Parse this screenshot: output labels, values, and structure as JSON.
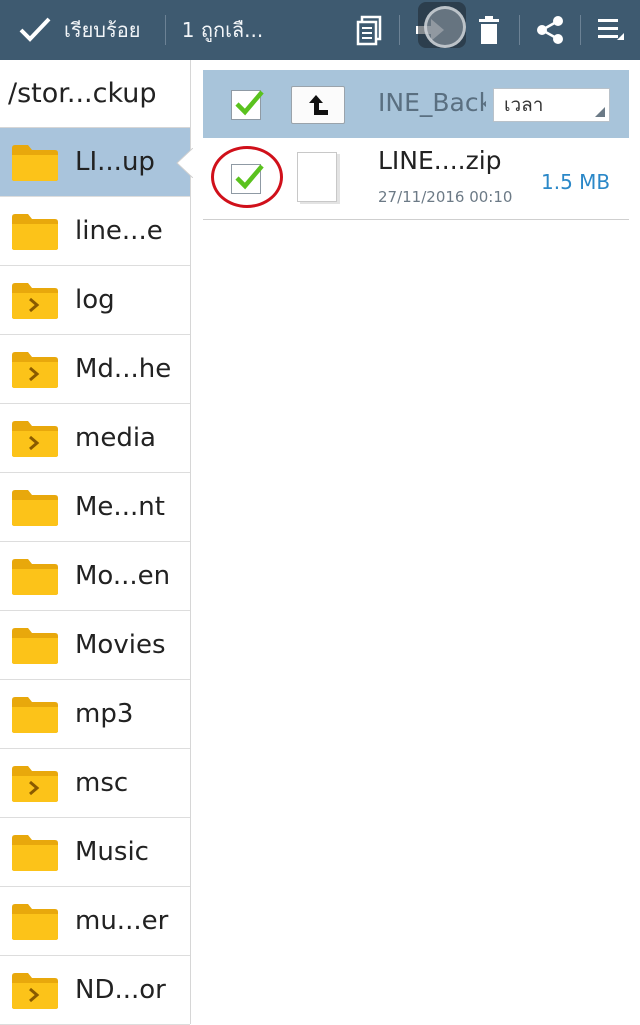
{
  "actionbar": {
    "done_label": "เรียบร้อย",
    "selected_label": "1 ถูกเลื...",
    "background": "#3e5a70"
  },
  "left_pane": {
    "path": "/stor...ckup",
    "folders": [
      {
        "name": "LI...up",
        "active": true,
        "icon": "folder-icon"
      },
      {
        "name": "line...e",
        "icon": "folder-icon"
      },
      {
        "name": "log",
        "icon": "folder-expand-icon"
      },
      {
        "name": "Md...he",
        "icon": "folder-expand-icon"
      },
      {
        "name": "media",
        "icon": "folder-expand-icon"
      },
      {
        "name": "Me...nt",
        "icon": "folder-icon"
      },
      {
        "name": "Mo...en",
        "icon": "folder-icon"
      },
      {
        "name": "Movies",
        "icon": "folder-icon"
      },
      {
        "name": "mp3",
        "icon": "folder-icon"
      },
      {
        "name": "msc",
        "icon": "folder-expand-icon"
      },
      {
        "name": "Music",
        "icon": "folder-icon"
      },
      {
        "name": "mu...er",
        "icon": "folder-icon"
      },
      {
        "name": "ND...or",
        "icon": "folder-expand-icon"
      }
    ]
  },
  "right_pane": {
    "header": {
      "folder_label": "INE_Backup",
      "sort_label": "เวลา",
      "background": "#a8c4da"
    },
    "files": [
      {
        "name": "LINE....zip",
        "date": "27/11/2016 00:10",
        "size": "1.5 MB",
        "checked": true
      }
    ]
  },
  "colors": {
    "active_row": "#a9c4dc",
    "size_text": "#2b88c8",
    "check_green": "#5ac21e",
    "highlight_ring": "#d0101a"
  }
}
